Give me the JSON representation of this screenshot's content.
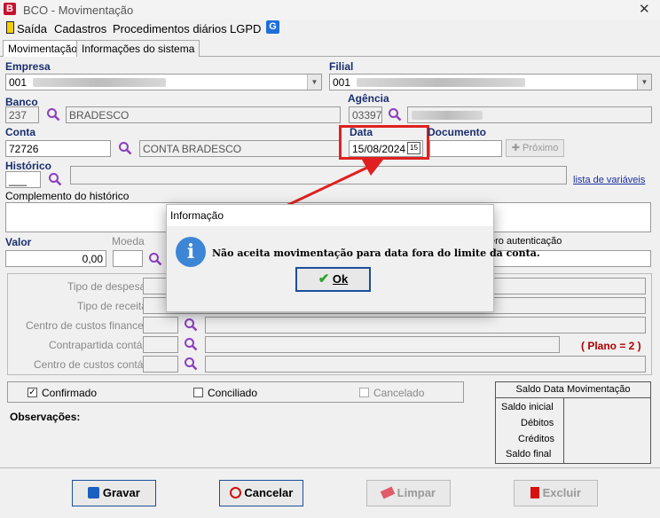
{
  "window": {
    "title": "BCO - Movimentação",
    "close": "✕",
    "app_icon": "B"
  },
  "menu": {
    "items": [
      "Saída",
      "Cadastros",
      "Procedimentos diários",
      "LGPD"
    ],
    "g_icon": "G"
  },
  "tabs": [
    "Movimentação",
    "Informações do sistema"
  ],
  "form": {
    "empresa_label": "Empresa",
    "empresa_code": "001",
    "filial_label": "Filial",
    "filial_code": "001",
    "banco_label": "Banco",
    "banco_code": "237",
    "banco_name": "BRADESCO",
    "agencia_label": "Agência",
    "agencia_code": "03397",
    "conta_label": "Conta",
    "conta_code": "72726",
    "conta_name": "CONTA BRADESCO",
    "data_label": "Data",
    "data_value": "15/08/2024",
    "cal_icon": "15",
    "documento_label": "Documento",
    "proximo_label": "Próximo",
    "historico_label": "Histórico",
    "historico_value": "___",
    "lista_variaveis": "lista de variáveis",
    "complemento_label": "Complemento do histórico",
    "valor_label": "Valor",
    "valor_value": "0,00",
    "moeda_label": "Moeda",
    "autenticacao_label": "ero autenticação",
    "tipo_despesa": "Tipo de despesa",
    "tipo_receita": "Tipo de receita",
    "centro_custos_fin": "Centro de custos financeiro",
    "contrapartida": "Contrapartida contábil",
    "centro_custos_cont": "Centro de custos contábil",
    "plano": "( Plano = 2 )",
    "confirmado": "Confirmado",
    "conciliado": "Conciliado",
    "cancelado": "Cancelado",
    "observacoes": "Observações:"
  },
  "saldo": {
    "title": "Saldo Data Movimentação",
    "rows": [
      "Saldo inicial",
      "Débitos",
      "Créditos",
      "Saldo final"
    ]
  },
  "buttons": {
    "gravar": "Gravar",
    "cancelar": "Cancelar",
    "limpar": "Limpar",
    "excluir": "Excluir"
  },
  "dialog": {
    "title": "Informação",
    "message": "Não aceita movimentação para data fora do limite da conta.",
    "ok": "Ok",
    "icon": "i"
  },
  "colors": {
    "highlight": "#e02020",
    "label_blue": "#1a2e6e",
    "plano_red": "#b00000",
    "accent": "#1b4f9c"
  }
}
